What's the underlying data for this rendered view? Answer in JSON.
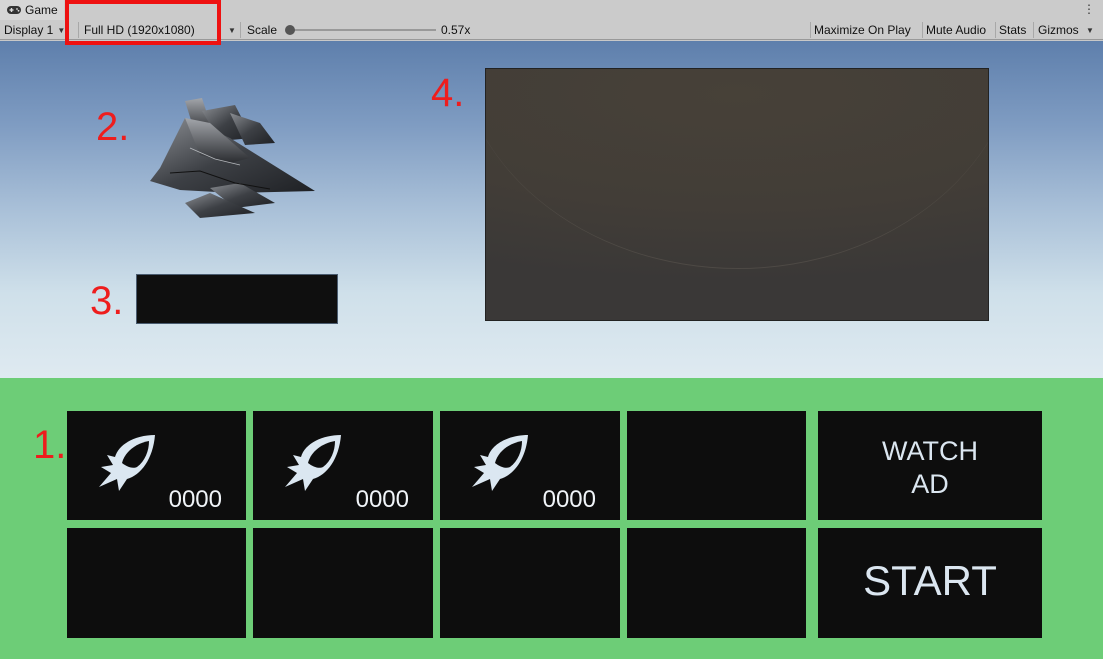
{
  "window": {
    "tab_title": "Game",
    "menu_glyph": "⋮"
  },
  "toolbar": {
    "display": "Display 1",
    "resolution": "Full HD (1920x1080)",
    "scale_label": "Scale",
    "scale_value": "0.57x",
    "scale_fraction": 0.02,
    "maximize": "Maximize On Play",
    "mute": "Mute Audio",
    "stats": "Stats",
    "gizmos": "Gizmos",
    "highlight_color": "#ee1111"
  },
  "annotations": {
    "m1": "1.",
    "m2": "2.",
    "m3": "3.",
    "m4": "4."
  },
  "grid": {
    "row1": [
      {
        "type": "boost",
        "icon": "boost-icon",
        "count": "0000"
      },
      {
        "type": "boost",
        "icon": "boost-icon",
        "count": "0000"
      },
      {
        "type": "boost",
        "icon": "boost-icon",
        "count": "0000"
      },
      {
        "type": "empty"
      }
    ],
    "row2": [
      {
        "type": "empty"
      },
      {
        "type": "empty"
      },
      {
        "type": "empty"
      },
      {
        "type": "empty"
      }
    ],
    "watch_ad_line1": "WATCH",
    "watch_ad_line2": "AD",
    "start": "START"
  },
  "colors": {
    "ground": "#6dcd77",
    "button_bg": "#0d0d0d",
    "annotation": "#ee1d1d"
  }
}
